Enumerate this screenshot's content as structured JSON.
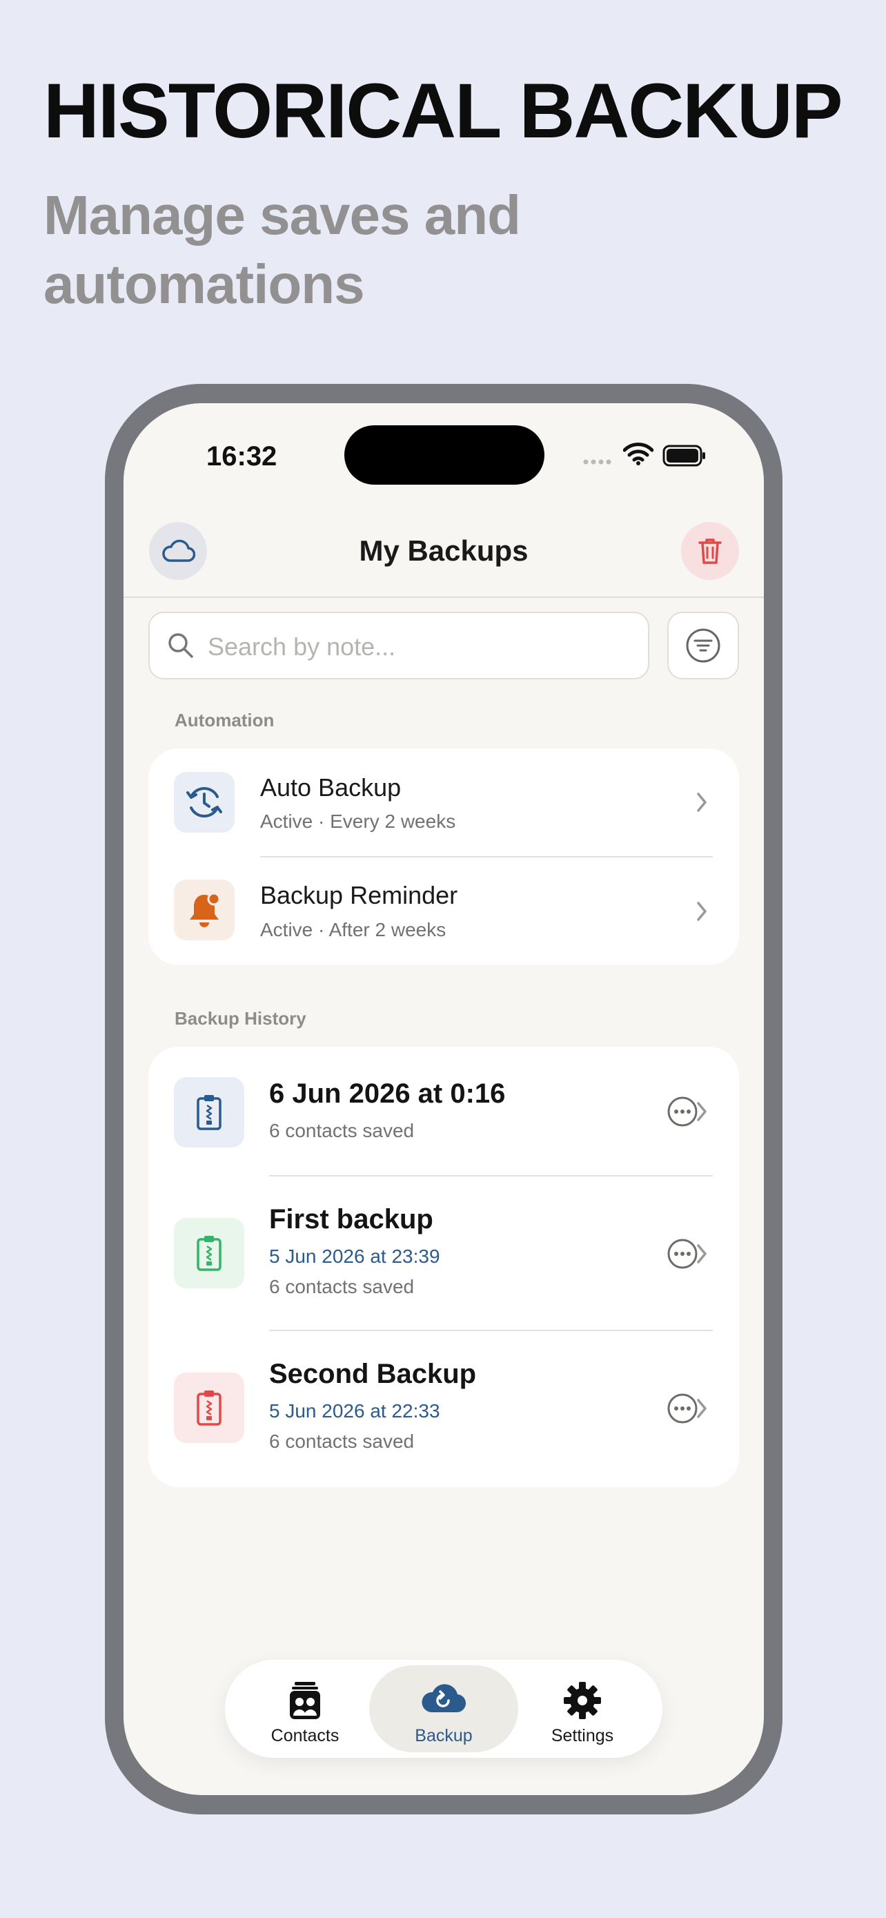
{
  "promo": {
    "headline": "HISTORICAL BACKUP",
    "subheadline": "Manage saves and automations"
  },
  "status_bar": {
    "time": "16:32"
  },
  "header": {
    "title": "My Backups",
    "left_icon": "cloud-icon",
    "right_icon": "trash-icon"
  },
  "search": {
    "placeholder": "Search by note..."
  },
  "automation": {
    "section_label": "Automation",
    "items": [
      {
        "title": "Auto Backup",
        "subtitle": "Active · Every 2 weeks",
        "icon": "clock-sync-icon"
      },
      {
        "title": "Backup Reminder",
        "subtitle": "Active · After 2 weeks",
        "icon": "bell-icon"
      }
    ]
  },
  "history": {
    "section_label": "Backup History",
    "items": [
      {
        "title": "6 Jun 2026 at 0:16",
        "date": "",
        "count": "6 contacts saved",
        "color": "#2b5a8c"
      },
      {
        "title": "First backup",
        "date": "5 Jun 2026 at 23:39",
        "count": "6 contacts saved",
        "color": "#34b36a"
      },
      {
        "title": "Second Backup",
        "date": "5 Jun 2026 at 22:33",
        "count": "6 contacts saved",
        "color": "#e0484a"
      }
    ]
  },
  "tabs": [
    {
      "label": "Contacts",
      "icon": "contacts-icon",
      "active": false
    },
    {
      "label": "Backup",
      "icon": "cloud-backup-icon",
      "active": true
    },
    {
      "label": "Settings",
      "icon": "gear-icon",
      "active": false
    }
  ],
  "colors": {
    "accent": "#2b5a8c",
    "background": "#e8eaf6",
    "screen": "#f7f6f2",
    "destructive": "#e0484a"
  }
}
